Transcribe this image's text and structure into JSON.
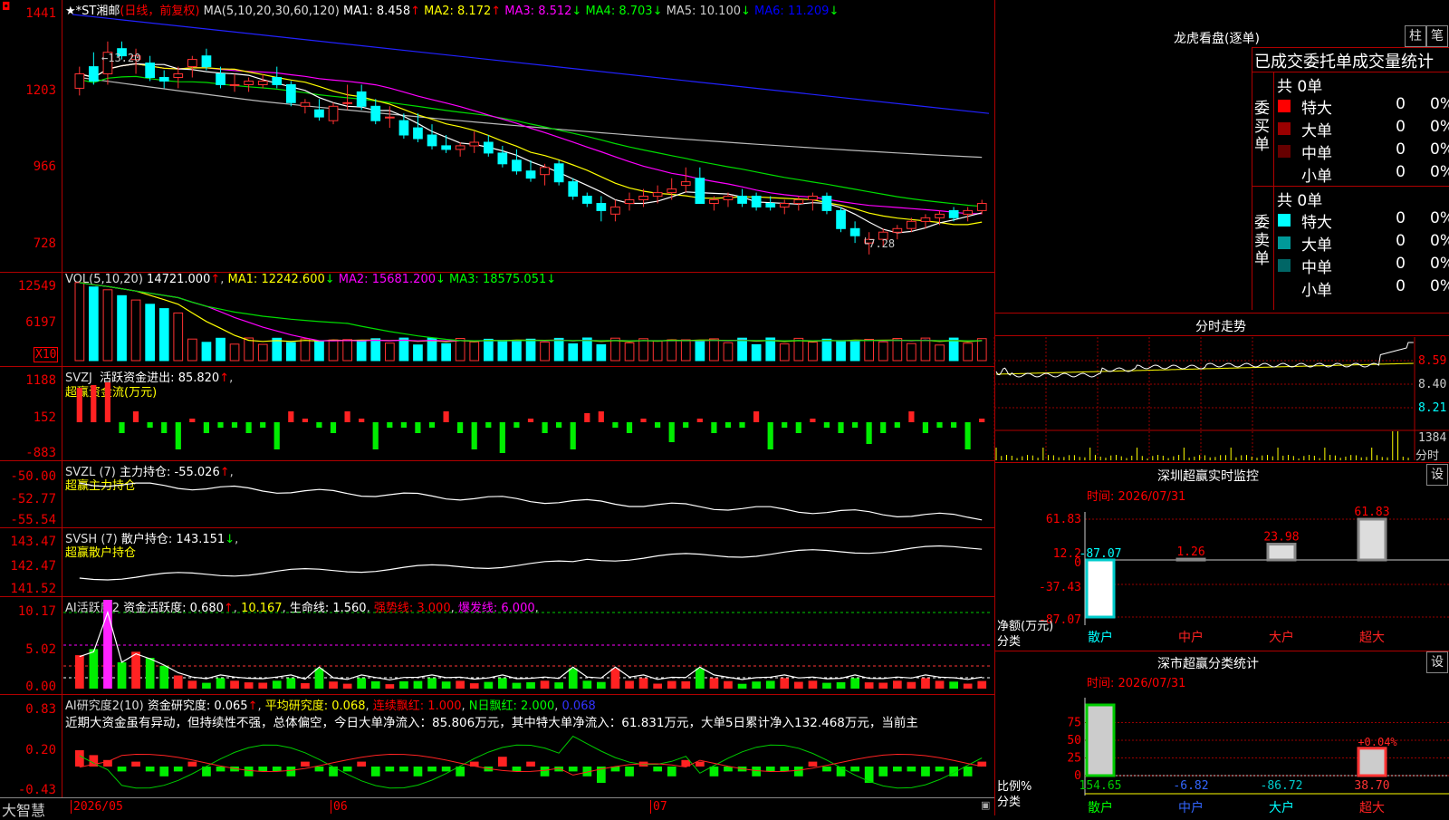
{
  "header": {
    "stock": "★*ST湘邮",
    "period": "(日线，前复权)",
    "ma_name": "MA(5,10,20,30,60,120)",
    "ma": [
      {
        "label": "MA1:",
        "value": "8.458",
        "arrow": "↑",
        "color": "#ffffff"
      },
      {
        "label": "MA2:",
        "value": "8.172",
        "arrow": "↑",
        "color": "#ffff00"
      },
      {
        "label": "MA3:",
        "value": "8.512",
        "arrow": "↓",
        "color": "#ff00ff"
      },
      {
        "label": "MA4:",
        "value": "8.703",
        "arrow": "↓",
        "color": "#00ff00"
      },
      {
        "label": "MA5:",
        "value": "10.100",
        "arrow": "↓",
        "color": "#cccccc"
      },
      {
        "label": "MA6:",
        "value": "11.209",
        "arrow": "↓",
        "color": "#0000ff"
      }
    ]
  },
  "kline": {
    "yaxis": [
      "1441",
      "1203",
      "966",
      "728"
    ],
    "high_label": "13.20",
    "low_label": "7.28",
    "ohlc": [
      [
        11.9,
        12.5,
        11.7,
        12.3
      ],
      [
        12.5,
        12.9,
        12.0,
        12.1
      ],
      [
        12.3,
        13.2,
        12.0,
        12.9
      ],
      [
        13.0,
        13.2,
        12.7,
        12.8
      ],
      [
        12.7,
        13.0,
        12.3,
        12.8
      ],
      [
        12.6,
        12.8,
        12.1,
        12.2
      ],
      [
        12.2,
        12.4,
        11.9,
        12.1
      ],
      [
        12.2,
        12.5,
        11.9,
        12.3
      ],
      [
        12.5,
        12.8,
        12.2,
        12.7
      ],
      [
        12.8,
        13.0,
        12.4,
        12.5
      ],
      [
        12.3,
        12.5,
        11.9,
        12.0
      ],
      [
        12.0,
        12.3,
        11.8,
        12.0
      ],
      [
        12.0,
        12.2,
        11.8,
        12.1
      ],
      [
        12.0,
        12.3,
        11.9,
        12.1
      ],
      [
        12.2,
        12.5,
        11.9,
        12.0
      ],
      [
        12.0,
        12.1,
        11.4,
        11.5
      ],
      [
        11.4,
        11.6,
        11.2,
        11.5
      ],
      [
        11.3,
        11.6,
        11.0,
        11.1
      ],
      [
        11.0,
        11.5,
        10.9,
        11.4
      ],
      [
        11.5,
        12.0,
        11.3,
        11.5
      ],
      [
        11.8,
        12.0,
        11.3,
        11.4
      ],
      [
        11.4,
        11.6,
        10.9,
        11.0
      ],
      [
        11.1,
        11.4,
        10.8,
        11.1
      ],
      [
        11.0,
        11.2,
        10.5,
        10.6
      ],
      [
        10.8,
        11.2,
        10.4,
        10.5
      ],
      [
        10.6,
        10.9,
        10.2,
        10.3
      ],
      [
        10.3,
        10.6,
        10.1,
        10.2
      ],
      [
        10.2,
        10.4,
        10.0,
        10.3
      ],
      [
        10.3,
        10.7,
        10.1,
        10.4
      ],
      [
        10.4,
        10.6,
        10.0,
        10.1
      ],
      [
        10.1,
        10.3,
        9.7,
        9.8
      ],
      [
        9.9,
        10.2,
        9.5,
        9.6
      ],
      [
        9.6,
        9.9,
        9.3,
        9.4
      ],
      [
        9.5,
        9.8,
        9.2,
        9.7
      ],
      [
        9.8,
        9.9,
        9.2,
        9.3
      ],
      [
        9.3,
        9.4,
        8.8,
        8.9
      ],
      [
        8.9,
        9.0,
        8.6,
        8.7
      ],
      [
        8.7,
        8.9,
        8.2,
        8.5
      ],
      [
        8.4,
        8.8,
        8.2,
        8.6
      ],
      [
        8.7,
        9.0,
        8.5,
        8.8
      ],
      [
        8.8,
        9.1,
        8.6,
        8.9
      ],
      [
        8.9,
        9.2,
        8.7,
        9.0
      ],
      [
        9.0,
        9.4,
        8.8,
        9.1
      ],
      [
        9.2,
        9.7,
        9.0,
        9.3
      ],
      [
        9.4,
        9.7,
        8.7,
        8.7
      ],
      [
        8.7,
        8.9,
        8.5,
        8.8
      ],
      [
        8.8,
        9.0,
        8.6,
        8.9
      ],
      [
        8.9,
        9.1,
        8.6,
        8.7
      ],
      [
        8.9,
        9.0,
        8.5,
        8.6
      ],
      [
        8.7,
        8.9,
        8.5,
        8.6
      ],
      [
        8.6,
        8.8,
        8.4,
        8.7
      ],
      [
        8.7,
        8.9,
        8.5,
        8.8
      ],
      [
        8.8,
        9.0,
        8.5,
        8.9
      ],
      [
        8.9,
        9.0,
        8.4,
        8.5
      ],
      [
        8.5,
        8.6,
        7.9,
        8.0
      ],
      [
        8.0,
        8.2,
        7.6,
        7.8
      ],
      [
        7.6,
        7.9,
        7.28,
        7.7
      ],
      [
        7.7,
        8.0,
        7.5,
        7.9
      ],
      [
        7.9,
        8.1,
        7.7,
        8.0
      ],
      [
        8.0,
        8.3,
        7.9,
        8.2
      ],
      [
        8.2,
        8.4,
        8.0,
        8.3
      ],
      [
        8.3,
        8.5,
        8.1,
        8.4
      ],
      [
        8.5,
        8.6,
        8.2,
        8.3
      ],
      [
        8.4,
        8.6,
        8.2,
        8.5
      ],
      [
        8.5,
        8.8,
        8.4,
        8.7
      ]
    ]
  },
  "vol": {
    "name": "VOL(5,10,20)",
    "value": "14721.000",
    "arrow": "↑",
    "ma": [
      {
        "label": "MA1:",
        "value": "12242.600",
        "arrow": "↓",
        "color": "#ffff00"
      },
      {
        "label": "MA2:",
        "value": "15681.200",
        "arrow": "↓",
        "color": "#ff00ff"
      },
      {
        "label": "MA3:",
        "value": "18575.051",
        "arrow": "↓",
        "color": "#00ff00"
      }
    ],
    "yaxis": [
      "12549",
      "6197"
    ],
    "unit": "X10"
  },
  "svzj": {
    "name": "SVZJ",
    "label": "活跃资金进出:",
    "value": "85.820",
    "arrow": "↑",
    "sub": "超赢资金流(万元)",
    "yaxis": [
      "1188",
      "152",
      "-883"
    ]
  },
  "svzl": {
    "name": "SVZL",
    "param": "(7)",
    "label": "主力持仓:",
    "value": "-55.026",
    "arrow": "↑",
    "sub": "超赢主力持仓",
    "yaxis": [
      "-50.00",
      "-52.77",
      "-55.54"
    ]
  },
  "svsh": {
    "name": "SVSH",
    "param": "(7)",
    "label": "散户持仓:",
    "value": "143.151",
    "arrow": "↓",
    "sub": "超赢散户持仓",
    "yaxis": [
      "143.47",
      "142.47",
      "141.52"
    ]
  },
  "ai1": {
    "name": "AI活跃度2",
    "label": "资金活跃度:",
    "value": "0.680",
    "arrow": "↑",
    "v2": "10.167",
    "l3": "生命线:",
    "v3": "1.560",
    "l4": "强势线:",
    "v4": "3.000",
    "l5": "爆发线:",
    "v5": "6.000",
    "yaxis": [
      "10.17",
      "5.02",
      "0.00"
    ]
  },
  "ai2": {
    "name": "AI研究度2(10)",
    "label": "资金研究度:",
    "value": "0.065",
    "arrow": "↑",
    "l2": "平均研究度:",
    "v2": "0.068",
    "l3": "连续飘红:",
    "v3": "1.000",
    "l4": "N日飘红:",
    "v4": "2.000",
    "v5": "0.068",
    "comment": "近期大资金虽有异动，但持续性不强，总体偏空，今日大单净流入：85.806万元，其中特大单净流入：61.831万元，大单5日累计净入132.468万元，当前主",
    "yaxis": [
      "0.83",
      "0.20",
      "-0.43"
    ]
  },
  "xaxis": {
    "brand": "大智慧",
    "labels": [
      "2026/05",
      "06",
      "07"
    ]
  },
  "lhb": {
    "title": "龙虎看盘(逐单)",
    "btn1": "柱",
    "btn2": "笔",
    "subtitle": "已成交委托单成交量统计",
    "buy_side": "委买单",
    "sell_side": "委卖单",
    "buy_total": "共 0单",
    "sell_total": "共 0单",
    "buy_rows": [
      {
        "label": "特大",
        "count": "0",
        "pct": "0%",
        "color": "#ff0000"
      },
      {
        "label": "大单",
        "count": "0",
        "pct": "0%",
        "color": "#990000"
      },
      {
        "label": "中单",
        "count": "0",
        "pct": "0%",
        "color": "#660000"
      },
      {
        "label": "小单",
        "count": "0",
        "pct": "0%",
        "color": "#000000"
      }
    ],
    "sell_rows": [
      {
        "label": "特大",
        "count": "0",
        "pct": "0%",
        "color": "#00ffff"
      },
      {
        "label": "大单",
        "count": "0",
        "pct": "0%",
        "color": "#009999"
      },
      {
        "label": "中单",
        "count": "0",
        "pct": "0%",
        "color": "#006666"
      },
      {
        "label": "小单",
        "count": "0",
        "pct": "0%",
        "color": "#000000"
      }
    ]
  },
  "fenshi": {
    "title": "分时走势",
    "yaxis": [
      "8.59",
      "8.40",
      "8.21"
    ],
    "vol_label": "1384",
    "unit": "分时"
  },
  "szmon": {
    "title": "深圳超赢实时监控",
    "btn": "设",
    "time": "时间: 2026/07/31",
    "yaxis": [
      "61.83",
      "12.2",
      "0",
      "-37.43",
      "-87.07"
    ],
    "ylabel1": "净额(万元)",
    "ylabel2": "分类",
    "bars": [
      {
        "cat": "散户",
        "value": -87.07,
        "label": "-87.07"
      },
      {
        "cat": "中户",
        "value": 1.26,
        "label": "1.26"
      },
      {
        "cat": "大户",
        "value": 23.98,
        "label": "23.98"
      },
      {
        "cat": "超大",
        "value": 61.83,
        "label": "61.83"
      }
    ]
  },
  "szstat": {
    "title": "深市超赢分类统计",
    "btn": "设",
    "time": "时间: 2026/07/31",
    "yaxis": [
      "75",
      "50",
      "25",
      "0"
    ],
    "ylabel1": "比例%",
    "ylabel2": "分类",
    "bars": [
      {
        "cat": "散户",
        "label": "154.65",
        "pct": 100,
        "color": "#00cc00"
      },
      {
        "cat": "中户",
        "label": "-6.82",
        "pct": 0,
        "color": "#3366ff"
      },
      {
        "cat": "大户",
        "label": "-86.72",
        "pct": 0,
        "color": "#00cccc"
      },
      {
        "cat": "超大",
        "label": "38.70",
        "pct": 38.7,
        "color": "#ff3333"
      }
    ],
    "overlay": "+0.04%"
  }
}
